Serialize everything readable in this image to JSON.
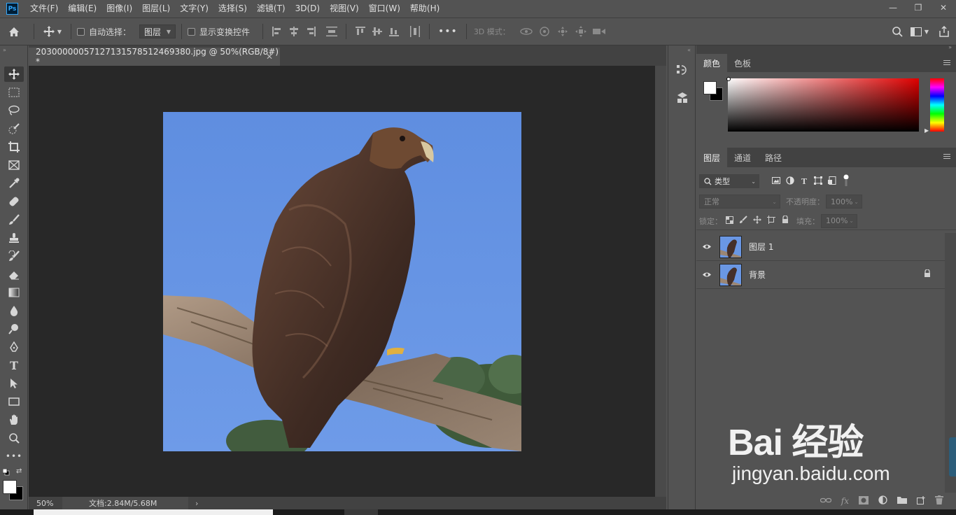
{
  "app": {
    "logo": "Ps",
    "menu": [
      "文件(F)",
      "编辑(E)",
      "图像(I)",
      "图层(L)",
      "文字(Y)",
      "选择(S)",
      "滤镜(T)",
      "3D(D)",
      "视图(V)",
      "窗口(W)",
      "帮助(H)"
    ],
    "window_controls": {
      "minimize": "—",
      "restore": "❐",
      "close": "✕"
    }
  },
  "options": {
    "auto_select_label": "自动选择：",
    "auto_select_target": "图层",
    "show_transform_label": "显示变换控件",
    "three_d_mode_label": "3D 模式：",
    "more": "•••"
  },
  "document": {
    "tab_title": "20300000057127131578512469380.jpg @ 50%(RGB/8#) *",
    "close": "✕",
    "zoom": "50%",
    "doc_size": "文档:2.84M/5.68M",
    "status_arrow": "›"
  },
  "color_panel": {
    "tabs": [
      "颜色",
      "色板"
    ],
    "foreground": "#ffffff",
    "background": "#000000",
    "hue": "#ff0000"
  },
  "layers_panel": {
    "tabs": [
      "图层",
      "通道",
      "路径"
    ],
    "filter_kind": "类型",
    "blend_mode": "正常",
    "opacity_label": "不透明度：",
    "opacity_value": "100%",
    "lock_label": "锁定：",
    "fill_label": "填充：",
    "fill_value": "100%",
    "layers": [
      {
        "name": "图层 1",
        "locked": false
      },
      {
        "name": "背景",
        "locked": true
      }
    ]
  },
  "watermark": {
    "brand": "Bai 经验",
    "url": "jingyan.baidu.com"
  }
}
